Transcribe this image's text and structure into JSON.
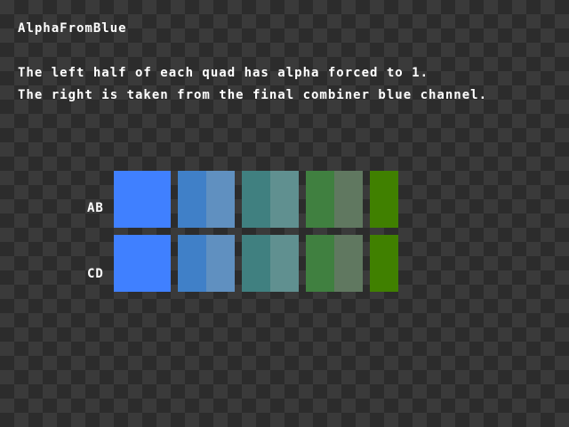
{
  "title": "AlphaFromBlue",
  "description": {
    "line1": "The left half of each quad has alpha forced to 1.",
    "line2": "The right is taken from the final combiner blue channel."
  },
  "rows": [
    {
      "label": "AB"
    },
    {
      "label": "CD"
    }
  ],
  "swatch_colors": [
    {
      "left": "#4080ff",
      "right": "#4080ff"
    },
    {
      "left": "#4080c8",
      "right": "#6090c0"
    },
    {
      "left": "#408080",
      "right": "#609090"
    },
    {
      "left": "#408040",
      "right": "#607860"
    },
    {
      "left": "#408000",
      "right": "#408000"
    }
  ]
}
